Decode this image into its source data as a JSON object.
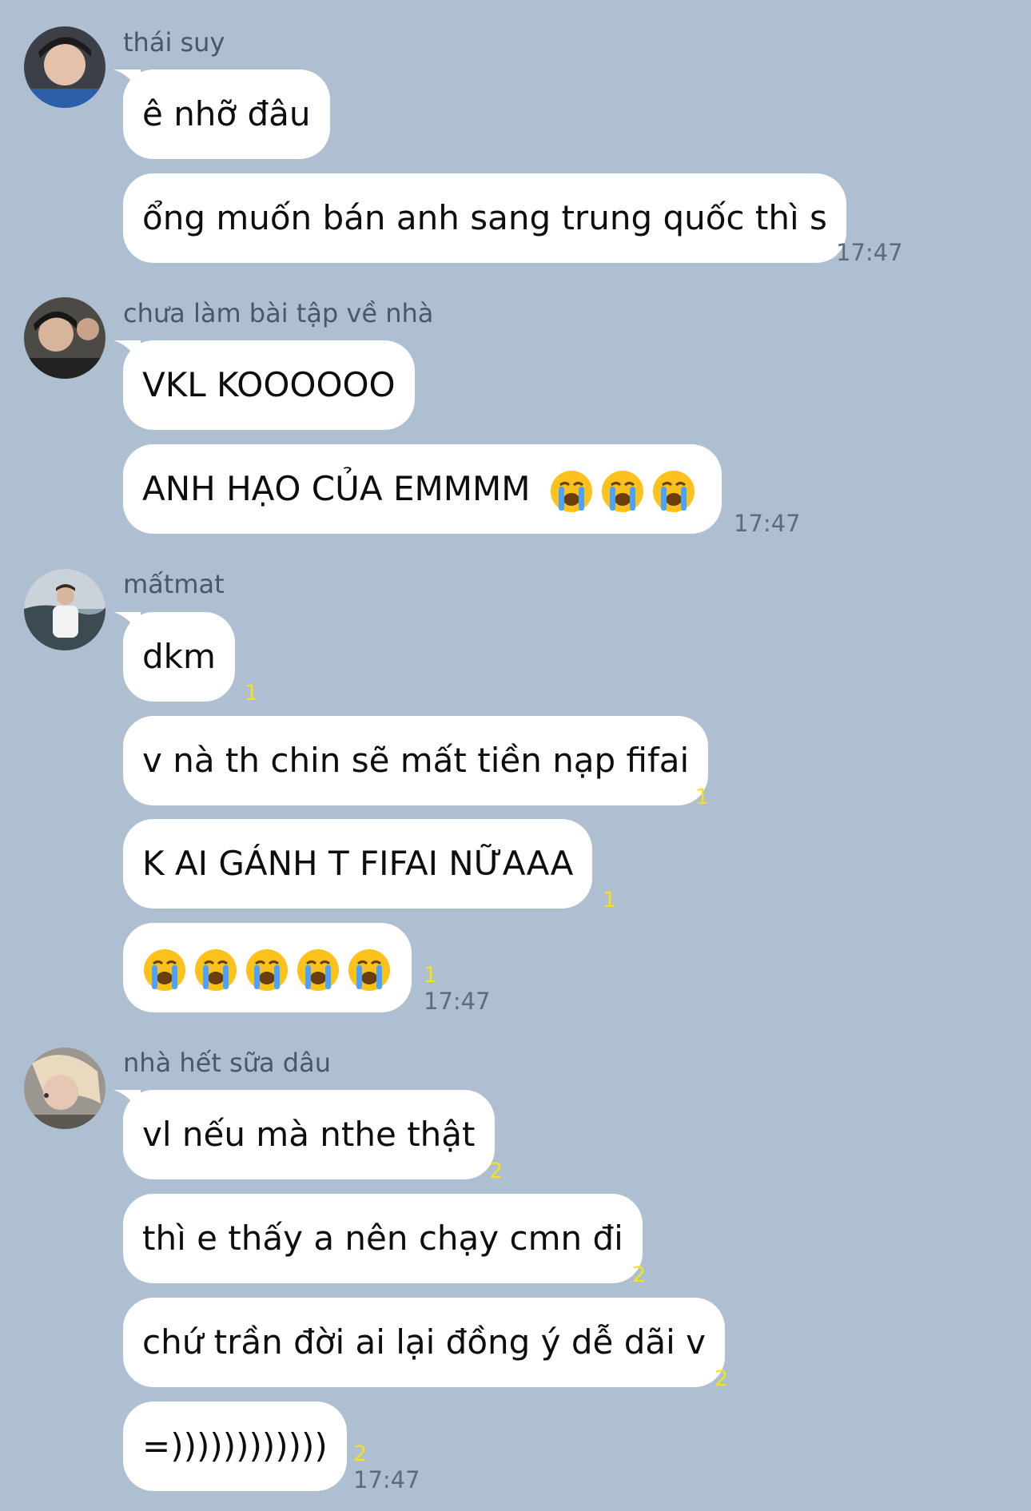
{
  "groups": [
    {
      "sender": "thái suy",
      "avatar": "avatar-photo-1",
      "messages": [
        {
          "text": "ê nhỡ đâu",
          "read": "",
          "time": ""
        },
        {
          "text": "ổng muốn bán anh sang trung quốc thì s",
          "read": "",
          "time": "17:47"
        }
      ]
    },
    {
      "sender": "chưa làm bài tập về nhà",
      "avatar": "avatar-photo-2",
      "messages": [
        {
          "text": "VKL KOOOOOO",
          "read": "",
          "time": ""
        },
        {
          "text": "ANH HẠO CỦA EMMMM",
          "emoji_count": 3,
          "emoji": "loudly-crying-face-icon",
          "read": "",
          "time": "17:47"
        }
      ]
    },
    {
      "sender": "mấtmat",
      "avatar": "avatar-photo-3",
      "messages": [
        {
          "text": "dkm",
          "read": "1",
          "time": ""
        },
        {
          "text": "v nà th chin sẽ mất tiền nạp fifai",
          "read": "1",
          "time": ""
        },
        {
          "text": "K AI GÁNH T FIFAI NỮAAA",
          "read": "1",
          "time": ""
        },
        {
          "text": "",
          "emoji_count": 5,
          "emoji": "loudly-crying-face-icon",
          "read": "1",
          "time": "17:47"
        }
      ]
    },
    {
      "sender": "nhà hết sữa dâu",
      "avatar": "avatar-photo-4",
      "messages": [
        {
          "text": "vl nếu mà nthe thật",
          "read": "2",
          "time": ""
        },
        {
          "text": "thì e thấy a nên chạy cmn đi",
          "read": "2",
          "time": ""
        },
        {
          "text": "chứ trần đời ai lại đồng ý dễ dãi v",
          "read": "2",
          "time": ""
        },
        {
          "text": "=))))))))))))",
          "read": "2",
          "time": "17:47"
        }
      ]
    }
  ],
  "colors": {
    "background": "#aebfd1",
    "bubble": "#ffffff",
    "read_receipt": "#f4e21c",
    "sender_name": "#4b5766",
    "timestamp": "#5e6b7a"
  }
}
